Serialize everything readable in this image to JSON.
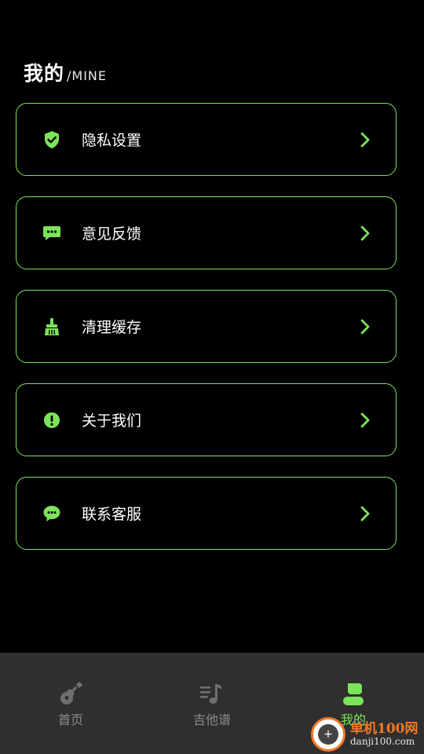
{
  "header": {
    "title": "我的",
    "subtitle": "/MINE"
  },
  "accent_color": "#7ce35a",
  "menu": {
    "items": [
      {
        "label": "隐私设置",
        "icon": "shield-check-icon"
      },
      {
        "label": "意见反馈",
        "icon": "chat-dots-icon"
      },
      {
        "label": "清理缓存",
        "icon": "broom-icon"
      },
      {
        "label": "关于我们",
        "icon": "info-exclamation-icon"
      },
      {
        "label": "联系客服",
        "icon": "chat-bubble-icon"
      }
    ]
  },
  "tabbar": {
    "tabs": [
      {
        "label": "首页",
        "icon": "guitar-icon",
        "active": false
      },
      {
        "label": "吉他谱",
        "icon": "music-list-icon",
        "active": false
      },
      {
        "label": "我的",
        "icon": "user-icon",
        "active": true
      }
    ]
  },
  "watermark": {
    "line1": "单机100网",
    "line2": "danji100.com"
  }
}
